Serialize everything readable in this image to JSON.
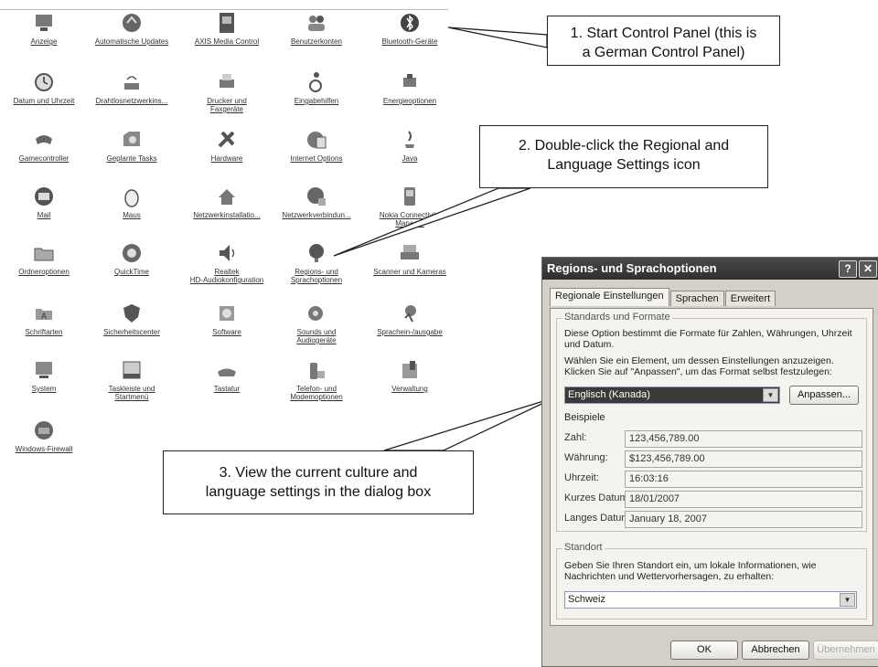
{
  "control_panel": {
    "items": [
      {
        "label": "Anzeige",
        "icon": "display-icon"
      },
      {
        "label": "Automatische Updates",
        "icon": "updates-icon"
      },
      {
        "label": "AXIS Media Control",
        "icon": "axis-media-icon"
      },
      {
        "label": "Benutzerkonten",
        "icon": "users-icon"
      },
      {
        "label": "Bluetooth-Geräte",
        "icon": "bluetooth-icon"
      },
      {
        "label": "Datum und Uhrzeit",
        "icon": "clock-icon"
      },
      {
        "label": "Drahtlosnetzwerkins...",
        "icon": "wireless-icon"
      },
      {
        "label": "Drucker und\nFaxgeräte",
        "icon": "printer-icon"
      },
      {
        "label": "Eingabehilfen",
        "icon": "accessibility-icon"
      },
      {
        "label": "Energieoptionen",
        "icon": "power-icon"
      },
      {
        "label": "Gamecontroller",
        "icon": "gamepad-icon"
      },
      {
        "label": "Geplante Tasks",
        "icon": "tasks-icon"
      },
      {
        "label": "Hardware",
        "icon": "hardware-icon"
      },
      {
        "label": "Internet Options",
        "icon": "internet-options-icon"
      },
      {
        "label": "Java",
        "icon": "java-icon"
      },
      {
        "label": "Mail",
        "icon": "mail-icon"
      },
      {
        "label": "Maus",
        "icon": "mouse-icon"
      },
      {
        "label": "Netzwerkinstallatio...",
        "icon": "network-setup-icon"
      },
      {
        "label": "Netzwerkverbindun...",
        "icon": "network-connections-icon"
      },
      {
        "label": "Nokia Connectivity\nManager",
        "icon": "nokia-icon"
      },
      {
        "label": "Ordneroptionen",
        "icon": "folder-options-icon"
      },
      {
        "label": "QuickTime",
        "icon": "quicktime-icon"
      },
      {
        "label": "Realtek\nHD-Audiokonfiguration",
        "icon": "speaker-icon"
      },
      {
        "label": "Regions- und\nSprachoptionen",
        "icon": "globe-icon"
      },
      {
        "label": "Scanner und Kameras",
        "icon": "scanner-icon"
      },
      {
        "label": "Schriftarten",
        "icon": "fonts-icon"
      },
      {
        "label": "Sicherheitscenter",
        "icon": "shield-icon"
      },
      {
        "label": "Software",
        "icon": "software-icon"
      },
      {
        "label": "Sounds und\nAudiogeräte",
        "icon": "sounds-icon"
      },
      {
        "label": "Sprachein-/ausgabe",
        "icon": "speech-icon"
      },
      {
        "label": "System",
        "icon": "system-icon"
      },
      {
        "label": "Taskleiste und\nStartmenü",
        "icon": "taskbar-icon"
      },
      {
        "label": "Tastatur",
        "icon": "keyboard-icon"
      },
      {
        "label": "Telefon- und\nModemoptionen",
        "icon": "phone-icon"
      },
      {
        "label": "Verwaltung",
        "icon": "admin-tools-icon"
      },
      {
        "label": "Windows-Firewall",
        "icon": "firewall-icon"
      }
    ]
  },
  "callouts": {
    "step1": "1. Start Control Panel (this is\na German Control Panel)",
    "step2": "2. Double-click the Regional and\nLanguage Settings icon",
    "step3": "3. View the current culture and\nlanguage settings in the dialog box"
  },
  "dialog": {
    "title": "Regions- und Sprachoptionen",
    "help": "?",
    "close": "✕",
    "tabs": [
      "Regionale Einstellungen",
      "Sprachen",
      "Erweitert"
    ],
    "standards_legend": "Standards und Formate",
    "standards_desc": "Diese Option bestimmt die Formate für Zahlen, Währungen, Uhrzeit und Datum.",
    "select_hint": "Wählen Sie ein Element, um dessen Einstellungen anzuzeigen. Klicken Sie auf \"Anpassen\", um das Format selbst festzulegen:",
    "format_value": "Englisch (Kanada)",
    "customize_label": "Anpassen...",
    "examples_label": "Beispiele",
    "examples": [
      {
        "label": "Zahl:",
        "value": "123,456,789.00"
      },
      {
        "label": "Währung:",
        "value": "$123,456,789.00"
      },
      {
        "label": "Uhrzeit:",
        "value": "16:03:16"
      },
      {
        "label": "Kurzes Datum:",
        "value": "18/01/2007"
      },
      {
        "label": "Langes Datum:",
        "value": "January 18, 2007"
      }
    ],
    "location_legend": "Standort",
    "location_desc": "Geben Sie Ihren Standort ein, um lokale Informationen, wie Nachrichten und Wettervorhersagen, zu erhalten:",
    "location_value": "Schweiz",
    "ok_label": "OK",
    "cancel_label": "Abbrechen",
    "apply_label": "Übernehmen"
  }
}
